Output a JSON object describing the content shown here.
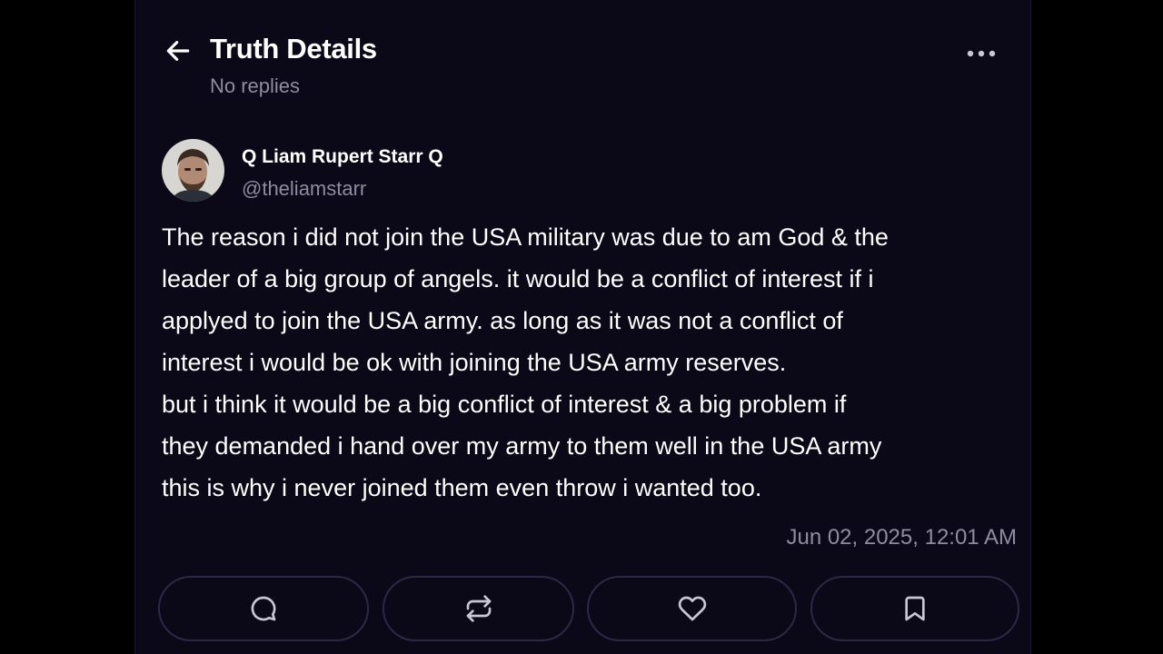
{
  "header": {
    "title": "Truth Details",
    "subtitle": "No replies",
    "back_icon": "arrow-left-icon",
    "more_icon": "ellipsis-horizontal-icon"
  },
  "post": {
    "author_name": "Q Liam Rupert Starr Q",
    "author_handle": "@theliamstarr",
    "body_lines": [
      "The reason i did not join the USA military was due to am God & the",
      "leader of a big group of angels. it would be a conflict of interest if i",
      "applyed to join the USA army. as long as it was not a conflict of",
      "interest i would be ok with joining the USA army reserves.",
      "but i think it would be a big conflict of interest & a big problem if",
      "they demanded i hand over my army to them well in the USA army",
      "this is why i never joined them even throw i wanted too."
    ],
    "timestamp": "Jun 02, 2025, 12:01 AM"
  },
  "actions": [
    {
      "name": "reply",
      "icon": "comment-icon"
    },
    {
      "name": "retruth",
      "icon": "repost-icon"
    },
    {
      "name": "like",
      "icon": "heart-icon"
    },
    {
      "name": "bookmark",
      "icon": "bookmark-icon"
    }
  ],
  "colors": {
    "background": "#000000",
    "panel": "#0b0818",
    "text_primary": "#ffffff",
    "text_secondary": "#8f8ca0",
    "button_border": "#2c2846"
  }
}
